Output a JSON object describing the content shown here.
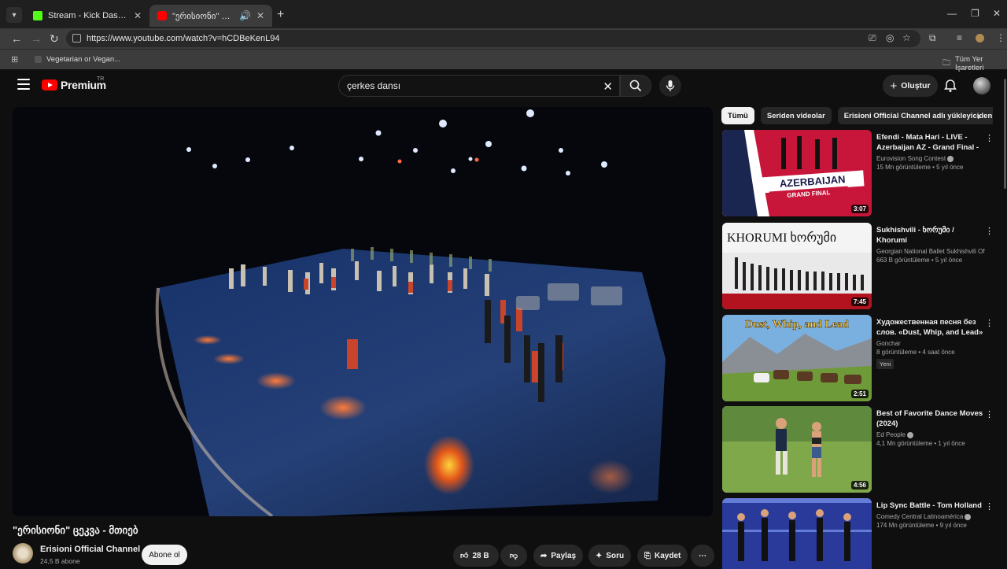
{
  "browser": {
    "tabs": [
      {
        "title": "Stream - Kick Dashboard",
        "favicon_color": "#53fc18"
      },
      {
        "title": "\"ერისიონი\" ცეკვა - მთიებ",
        "favicon_color": "#ff0000"
      }
    ],
    "url": "https://www.youtube.com/watch?v=hCDBeKenL94",
    "bookmarks": [
      {
        "label": "Vegetarian or Vegan..."
      },
      {
        "label": "Tüm Yer İşaretleri"
      }
    ]
  },
  "youtube": {
    "logo_text": "Premium",
    "logo_region": "TR",
    "search_query": "çerkes dansı",
    "create_label": "Oluştur"
  },
  "video": {
    "title": "\"ერისიონი\" ცეკვა - მთიებ",
    "channel": "Erisioni Official Channel",
    "subscribers": "24,5 B abone",
    "subscribe_label": "Abone ol",
    "likes": "28 B",
    "share_label": "Paylaş",
    "ask_label": "Soru",
    "save_label": "Kaydet"
  },
  "chips": [
    "Tümü",
    "Seriden videolar",
    "Erisioni Official Channel adlı yükleyiciden"
  ],
  "recommendations": [
    {
      "title": "Efendi - Mata Hari - LIVE - Azerbaijan AZ - Grand Final - ...",
      "channel": "Eurovision Song Contest",
      "verified": true,
      "meta": "15 Mn görüntüleme • 5 yıl önce",
      "duration": "3:07",
      "new": ""
    },
    {
      "title": "Sukhishvili - ხორუმი / Khorumi",
      "channel": "Georgian National Ballet Sukhishvili Offic...",
      "verified": false,
      "meta": "663 B görüntüleme • 5 yıl önce",
      "duration": "7:45",
      "new": ""
    },
    {
      "title": "Художественная песня без слов. «Dust, Whip, and Lead» -...",
      "channel": "Gonchar",
      "verified": false,
      "meta": "8 görüntüleme • 4 saat önce",
      "duration": "2:51",
      "new": "Yeni"
    },
    {
      "title": "Best of Favorite Dance Moves (2024)",
      "channel": "Ed People",
      "verified": true,
      "meta": "4,1 Mn görüntüleme • 1 yıl önce",
      "duration": "4:56",
      "new": ""
    },
    {
      "title": "Lip Sync Battle - Tom Holland",
      "channel": "Comedy Central Latinoamérica",
      "verified": true,
      "meta": "174 Mn görüntüleme • 9 yıl önce",
      "duration": "",
      "new": ""
    }
  ],
  "thumb_texts": {
    "azerbaijan": "AZERBAIJAN",
    "grand_final": "GRAND FINAL",
    "khorumi": "KHORUMI ხორუმი",
    "dust": "Dust, Whip, and Lead"
  }
}
